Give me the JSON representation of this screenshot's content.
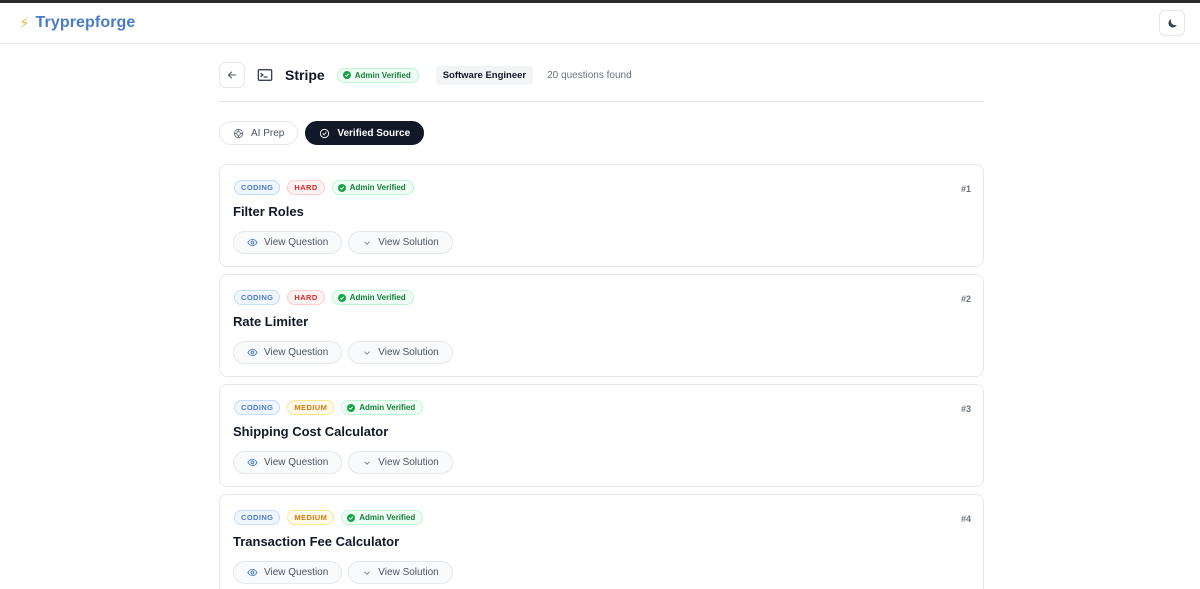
{
  "brand": {
    "name": "Tryprepforge",
    "icon": "lightning-icon",
    "color": "#4a7bc8"
  },
  "header": {
    "company": "Stripe",
    "verified_label": "Admin Verified",
    "role": "Software Engineer",
    "count_text": "20 questions found"
  },
  "tabs": [
    {
      "label": "AI Prep",
      "icon": "brain-icon",
      "active": false
    },
    {
      "label": "Verified Source",
      "icon": "check-circle-icon",
      "active": true
    }
  ],
  "questions": [
    {
      "category": "CODING",
      "difficulty": "HARD",
      "verified": "Admin Verified",
      "title": "Filter Roles",
      "number": "#1",
      "view_question": "View Question",
      "view_solution": "View Solution"
    },
    {
      "category": "CODING",
      "difficulty": "HARD",
      "verified": "Admin Verified",
      "title": "Rate Limiter",
      "number": "#2",
      "view_question": "View Question",
      "view_solution": "View Solution"
    },
    {
      "category": "CODING",
      "difficulty": "MEDIUM",
      "verified": "Admin Verified",
      "title": "Shipping Cost Calculator",
      "number": "#3",
      "view_question": "View Question",
      "view_solution": "View Solution"
    },
    {
      "category": "CODING",
      "difficulty": "MEDIUM",
      "verified": "Admin Verified",
      "title": "Transaction Fee Calculator",
      "number": "#4",
      "view_question": "View Question",
      "view_solution": "View Solution"
    }
  ],
  "colors": {
    "accent_dark": "#111827",
    "verified_green": "#15803d",
    "hard_red": "#dc2626",
    "medium_amber": "#d97706",
    "coding_blue": "#4a7bc8"
  }
}
